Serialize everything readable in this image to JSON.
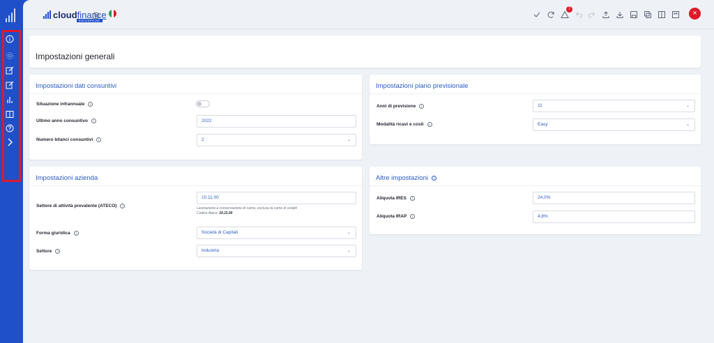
{
  "brand": {
    "cloud": "cloud",
    "finance": "finance",
    "sub": "ENTERPRISE"
  },
  "toolbar": {
    "notification_count": "7",
    "close": "×"
  },
  "sidebar": {
    "icons": [
      "info-icon",
      "gear-icon",
      "edit-icon",
      "edit-icon",
      "chart-icon",
      "book-icon",
      "help-icon",
      "chevron-right-icon"
    ]
  },
  "page": {
    "title": "Impostazioni generali"
  },
  "consuntivi": {
    "title": "Impostazioni dati consuntivi",
    "situazione_label": "Situazione infrannuale",
    "ultimo_label": "Ultimo anno consuntivo",
    "ultimo_value": "2022",
    "numero_label": "Numero bilanci consuntivi",
    "numero_value": "2"
  },
  "previsionale": {
    "title": "Impostazioni piano previsionale",
    "anni_label": "Anni di previsione",
    "anni_value": "11",
    "modalita_label": "Modalità ricavi e costi",
    "modalita_value": "Easy"
  },
  "azienda": {
    "title": "Impostazioni azienda",
    "settore_attivita_label": "Settore di attività prevalente (ATECO)",
    "ateco_value": "10.11.00",
    "ateco_desc": "Lavorazione e conservazione di carne, esclusa la carne di volatili",
    "ateco_code_label": "Codice Ateco:",
    "ateco_code": "10.11.00",
    "forma_label": "Forma giuridica",
    "forma_value": "Società di Capitali",
    "settore_label": "Settore",
    "settore_value": "Industria"
  },
  "altre": {
    "title": "Altre impostazioni",
    "ires_label": "Aliquota IRES",
    "ires_value": "24,0%",
    "irap_label": "Aliquota IRAP",
    "irap_value": "4,8%"
  },
  "colors": {
    "accent": "#1f4fc9",
    "title_blue": "#2a5bc7",
    "danger": "#e0192a",
    "bg": "#eef1f6"
  }
}
